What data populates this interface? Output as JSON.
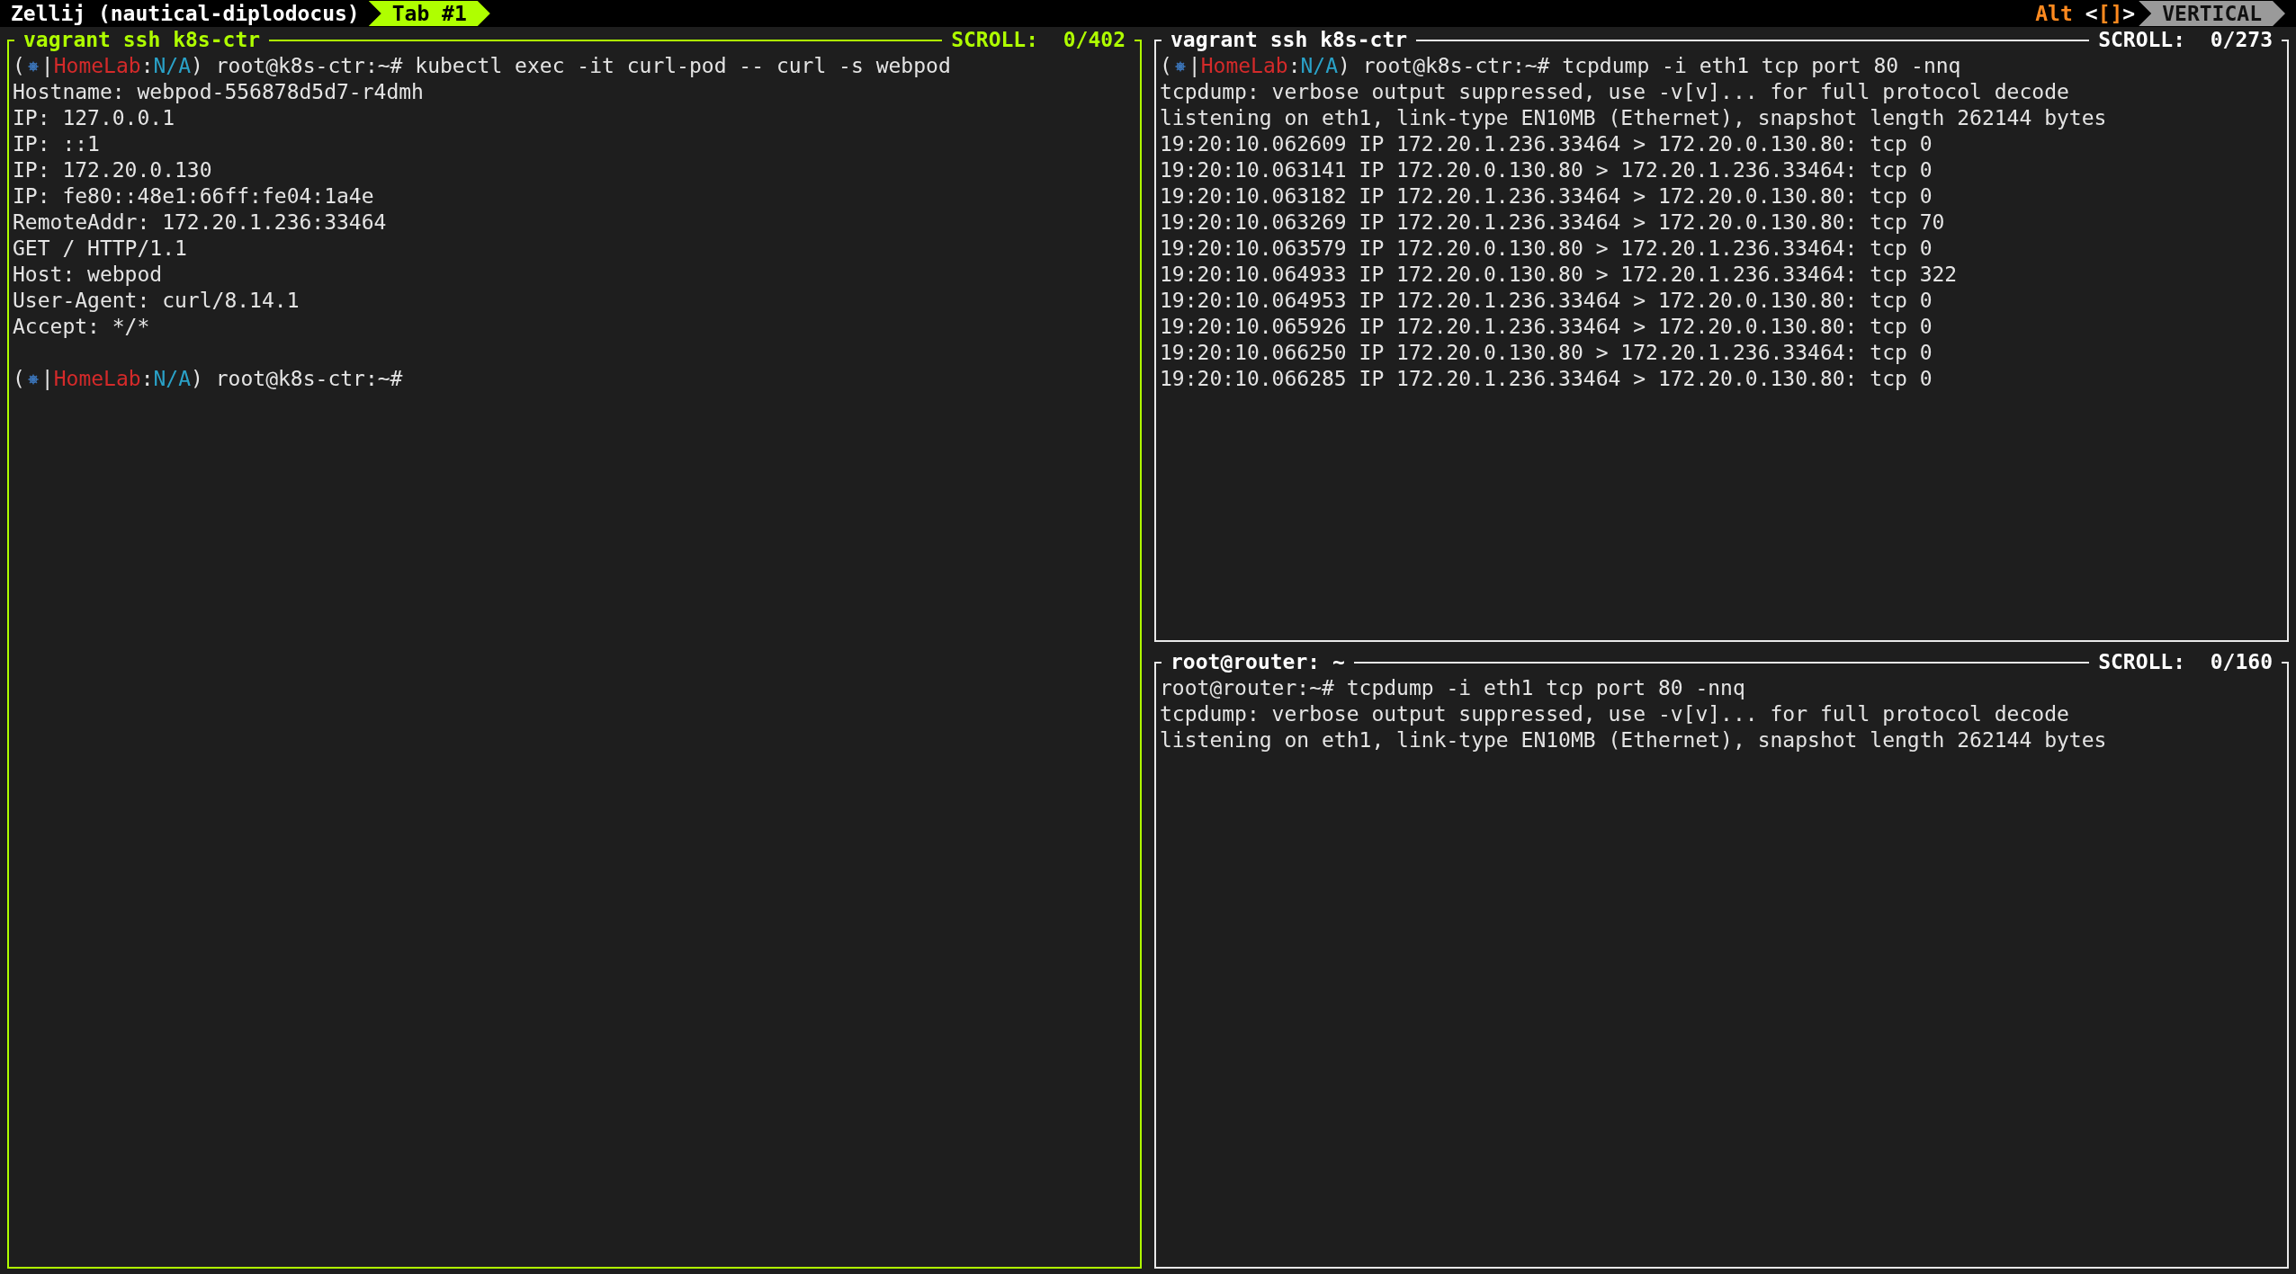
{
  "tab_bar": {
    "session": "Zellij (nautical-diplodocus)",
    "tabs": [
      {
        "label": "Tab #1",
        "selected": true
      }
    ],
    "hint": [
      {
        "kind": "key",
        "text": "Alt"
      },
      {
        "kind": "plain",
        "text": "<"
      },
      {
        "kind": "key",
        "text": "[]"
      },
      {
        "kind": "plain",
        "text": ">"
      }
    ],
    "mode": "VERTICAL"
  },
  "panes": [
    {
      "title": "vagrant ssh k8s-ctr",
      "scroll": "SCROLL:  0/402",
      "focused": true,
      "lines": [
        {
          "kind": "prompt",
          "segments": [
            {
              "kind": "plain",
              "text": "("
            },
            {
              "kind": "icon"
            },
            {
              "kind": "plain",
              "text": "|"
            },
            {
              "kind": "context",
              "text": "HomeLab"
            },
            {
              "kind": "plain",
              "text": ":"
            },
            {
              "kind": "namespace",
              "text": "N/A"
            },
            {
              "kind": "plain",
              "text": ") root@k8s-ctr:~# kubectl exec -it curl-pod -- curl -s webpod"
            }
          ]
        },
        {
          "kind": "text",
          "text": "Hostname: webpod-556878d5d7-r4dmh"
        },
        {
          "kind": "text",
          "text": "IP: 127.0.0.1"
        },
        {
          "kind": "text",
          "text": "IP: ::1"
        },
        {
          "kind": "text",
          "text": "IP: 172.20.0.130"
        },
        {
          "kind": "text",
          "text": "IP: fe80::48e1:66ff:fe04:1a4e"
        },
        {
          "kind": "text",
          "text": "RemoteAddr: 172.20.1.236:33464"
        },
        {
          "kind": "text",
          "text": "GET / HTTP/1.1"
        },
        {
          "kind": "text",
          "text": "Host: webpod"
        },
        {
          "kind": "text",
          "text": "User-Agent: curl/8.14.1"
        },
        {
          "kind": "text",
          "text": "Accept: */*"
        },
        {
          "kind": "blank"
        },
        {
          "kind": "prompt",
          "segments": [
            {
              "kind": "plain",
              "text": "("
            },
            {
              "kind": "icon"
            },
            {
              "kind": "plain",
              "text": "|"
            },
            {
              "kind": "context",
              "text": "HomeLab"
            },
            {
              "kind": "plain",
              "text": ":"
            },
            {
              "kind": "namespace",
              "text": "N/A"
            },
            {
              "kind": "plain",
              "text": ") root@k8s-ctr:~#"
            }
          ]
        }
      ]
    },
    {
      "title": "vagrant ssh k8s-ctr",
      "scroll": "SCROLL:  0/273",
      "focused": false,
      "lines": [
        {
          "kind": "prompt",
          "segments": [
            {
              "kind": "plain",
              "text": "("
            },
            {
              "kind": "icon"
            },
            {
              "kind": "plain",
              "text": "|"
            },
            {
              "kind": "context",
              "text": "HomeLab"
            },
            {
              "kind": "plain",
              "text": ":"
            },
            {
              "kind": "namespace",
              "text": "N/A"
            },
            {
              "kind": "plain",
              "text": ") root@k8s-ctr:~# tcpdump -i eth1 tcp port 80 -nnq"
            }
          ]
        },
        {
          "kind": "text",
          "text": "tcpdump: verbose output suppressed, use -v[v]... for full protocol decode"
        },
        {
          "kind": "text",
          "text": "listening on eth1, link-type EN10MB (Ethernet), snapshot length 262144 bytes"
        },
        {
          "kind": "text",
          "text": "19:20:10.062609 IP 172.20.1.236.33464 > 172.20.0.130.80: tcp 0"
        },
        {
          "kind": "text",
          "text": "19:20:10.063141 IP 172.20.0.130.80 > 172.20.1.236.33464: tcp 0"
        },
        {
          "kind": "text",
          "text": "19:20:10.063182 IP 172.20.1.236.33464 > 172.20.0.130.80: tcp 0"
        },
        {
          "kind": "text",
          "text": "19:20:10.063269 IP 172.20.1.236.33464 > 172.20.0.130.80: tcp 70"
        },
        {
          "kind": "text",
          "text": "19:20:10.063579 IP 172.20.0.130.80 > 172.20.1.236.33464: tcp 0"
        },
        {
          "kind": "text",
          "text": "19:20:10.064933 IP 172.20.0.130.80 > 172.20.1.236.33464: tcp 322"
        },
        {
          "kind": "text",
          "text": "19:20:10.064953 IP 172.20.1.236.33464 > 172.20.0.130.80: tcp 0"
        },
        {
          "kind": "text",
          "text": "19:20:10.065926 IP 172.20.1.236.33464 > 172.20.0.130.80: tcp 0"
        },
        {
          "kind": "text",
          "text": "19:20:10.066250 IP 172.20.0.130.80 > 172.20.1.236.33464: tcp 0"
        },
        {
          "kind": "text",
          "text": "19:20:10.066285 IP 172.20.1.236.33464 > 172.20.0.130.80: tcp 0"
        }
      ]
    },
    {
      "title": "root@router: ~",
      "scroll": "SCROLL:  0/160",
      "focused": false,
      "lines": [
        {
          "kind": "text",
          "text": "root@router:~# tcpdump -i eth1 tcp port 80 -nnq"
        },
        {
          "kind": "text",
          "text": "tcpdump: verbose output suppressed, use -v[v]... for full protocol decode"
        },
        {
          "kind": "text",
          "text": "listening on eth1, link-type EN10MB (Ethernet), snapshot length 262144 bytes"
        }
      ]
    }
  ]
}
